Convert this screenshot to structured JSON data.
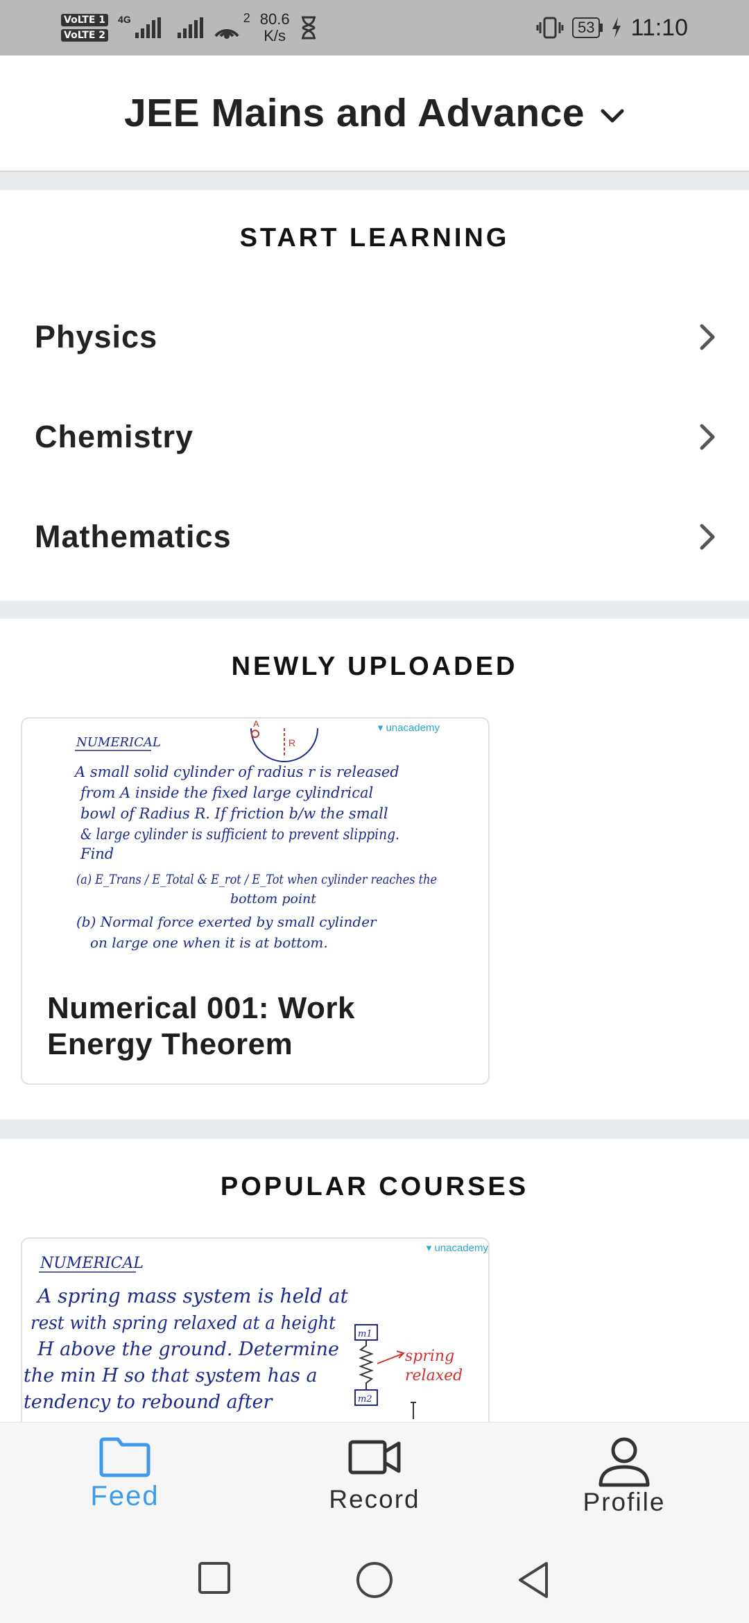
{
  "status_bar": {
    "network_1": "VoLTE 1",
    "network_2": "VoLTE 2",
    "network_type": "4G",
    "data_speed_value": "80.6",
    "data_speed_unit": "K/s",
    "wifi_badge": "2",
    "battery": "53",
    "time": "11:10"
  },
  "header": {
    "title": "JEE Mains and Advance"
  },
  "start_learning": {
    "title": "START LEARNING",
    "subjects": [
      {
        "label": "Physics"
      },
      {
        "label": "Chemistry"
      },
      {
        "label": "Mathematics"
      }
    ]
  },
  "newly_uploaded": {
    "title": "NEWLY UPLOADED",
    "lesson": {
      "title": "Numerical 001: Work Energy Theorem",
      "brand": "unacademy",
      "thumb_heading": "NUMERICAL",
      "thumb_lines": [
        "A small solid cylinder of radius r is released",
        "from A inside the fixed large cylindrical",
        "bowl of Radius R. If friction b/w the small",
        "& large cylinder is sufficient to prevent slipping.",
        "Find",
        "(a) E_Trans / E_Total & E_rot / E_Tot when cylinder reaches the",
        "bottom point",
        "(b) Normal force exerted by small cylinder",
        "on large one when it is at bottom."
      ],
      "diagram_labels": [
        "A",
        "R"
      ]
    }
  },
  "popular_courses": {
    "title": "POPULAR COURSES",
    "course": {
      "brand": "unacademy",
      "thumb_heading": "NUMERICAL",
      "thumb_lines": [
        "A spring mass system is held at",
        "rest with spring relaxed at a height",
        "H above the ground. Determine",
        "the min H so that system has a",
        "tendency to rebound after"
      ],
      "diagram_labels": [
        "m1",
        "m2",
        "spring",
        "relaxed"
      ]
    }
  },
  "bottom_nav": {
    "items": [
      {
        "label": "Feed",
        "icon": "folder-icon",
        "active": true
      },
      {
        "label": "Record",
        "icon": "video-camera-icon",
        "active": false
      },
      {
        "label": "Profile",
        "icon": "person-icon",
        "active": false
      }
    ],
    "accent": "#3d9be9"
  }
}
